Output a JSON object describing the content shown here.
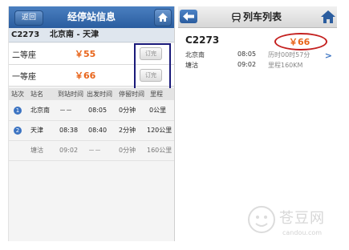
{
  "left": {
    "back_label": "返回",
    "title": "经停站信息",
    "train_code": "C2273",
    "route": "北京南 - 天津",
    "seats": [
      {
        "seat": "二等座",
        "price": "￥55",
        "button": "订完"
      },
      {
        "seat": "一等座",
        "price": "￥66",
        "button": "订完"
      }
    ],
    "table_headers": [
      "站次",
      "站名",
      "到站时间",
      "出发时间",
      "停留时间",
      "里程"
    ],
    "stops": [
      {
        "index": "1",
        "name": "北京南",
        "arrive": "－－",
        "depart": "08:05",
        "stay": "0分钟",
        "distance": "0公里"
      },
      {
        "index": "2",
        "name": "天津",
        "arrive": "08:38",
        "depart": "08:40",
        "stay": "2分钟",
        "distance": "120公里"
      },
      {
        "index": "",
        "name": "塘沽",
        "arrive": "09:02",
        "depart": "－－",
        "stay": "0分钟",
        "distance": "160公里"
      }
    ]
  },
  "right": {
    "title": "列车列表",
    "train_code": "C2273",
    "price": "￥66",
    "from_station": "北京南",
    "from_time": "08:05",
    "duration": "历时00时57分",
    "to_station": "塘沽",
    "to_time": "09:02",
    "distance": "里程160KM"
  },
  "watermark": {
    "text": "苍豆网",
    "sub": "candou.com"
  },
  "colors": {
    "header_blue": "#2a5d9f",
    "price_orange": "#e8641a",
    "highlight_red": "#c4201f",
    "highlight_navy": "#1a1a7a"
  }
}
